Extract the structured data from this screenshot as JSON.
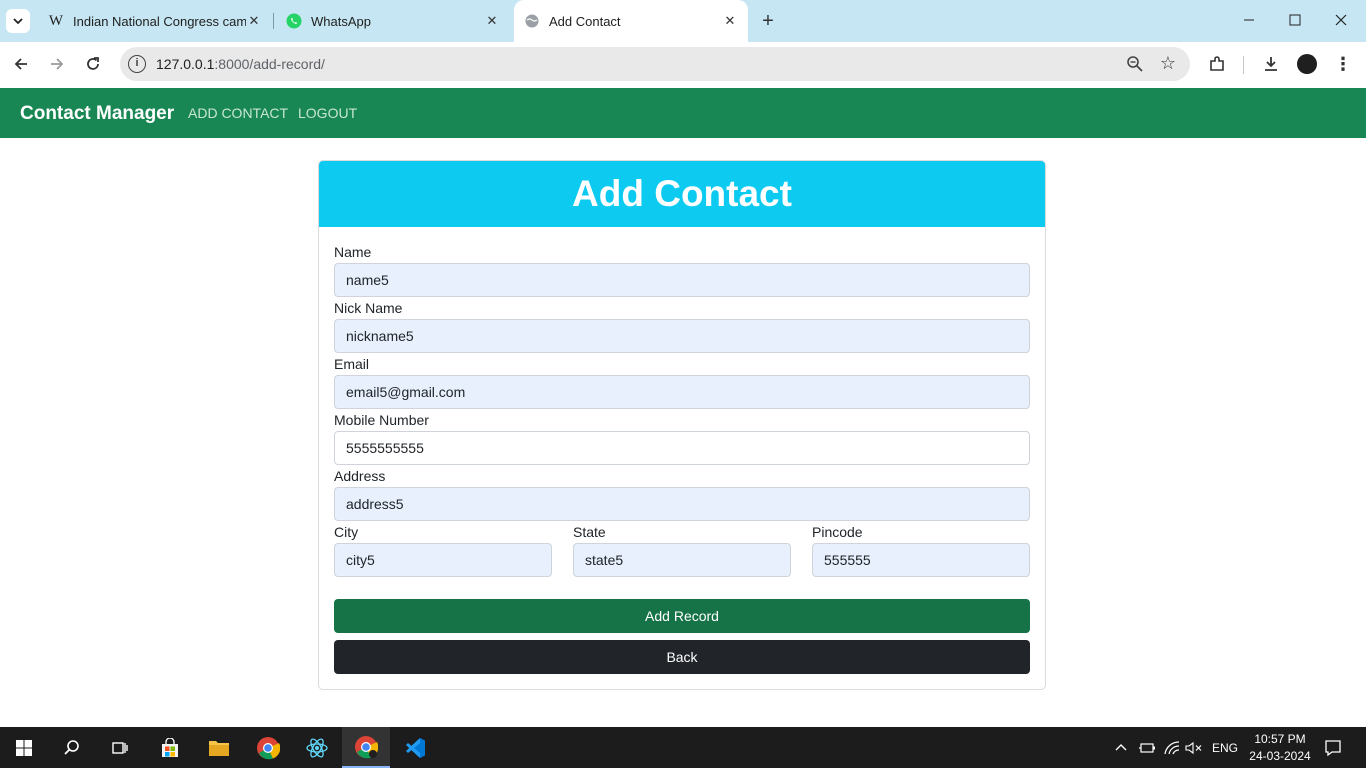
{
  "browser": {
    "tabs": [
      {
        "title": "Indian National Congress camp",
        "favicon": "wikipedia-icon",
        "active": false
      },
      {
        "title": "WhatsApp",
        "favicon": "whatsapp-icon",
        "active": false
      },
      {
        "title": "Add Contact",
        "favicon": "globe-icon",
        "active": true
      }
    ],
    "url_host": "127.0.0.1",
    "url_path": ":8000/add-record/"
  },
  "site": {
    "brand": "Contact Manager",
    "nav": [
      "ADD CONTACT",
      "LOGOUT"
    ]
  },
  "form": {
    "title": "Add Contact",
    "name_label": "Name",
    "name_value": "name5",
    "nickname_label": "Nick Name",
    "nickname_value": "nickname5",
    "email_label": "Email",
    "email_value": "email5@gmail.com",
    "mobile_label": "Mobile Number",
    "mobile_value": "5555555555",
    "address_label": "Address",
    "address_value": "address5",
    "city_label": "City",
    "city_value": "city5",
    "state_label": "State",
    "state_value": "state5",
    "pincode_label": "Pincode",
    "pincode_value": "555555",
    "add_button": "Add Record",
    "back_button": "Back"
  },
  "taskbar": {
    "language": "ENG",
    "time": "10:57 PM",
    "date": "24-03-2024"
  },
  "colors": {
    "navbar": "#198754",
    "header": "#0dcaf0",
    "add_button": "#157347",
    "back_button": "#212529",
    "autofill": "#e8f0fe"
  }
}
